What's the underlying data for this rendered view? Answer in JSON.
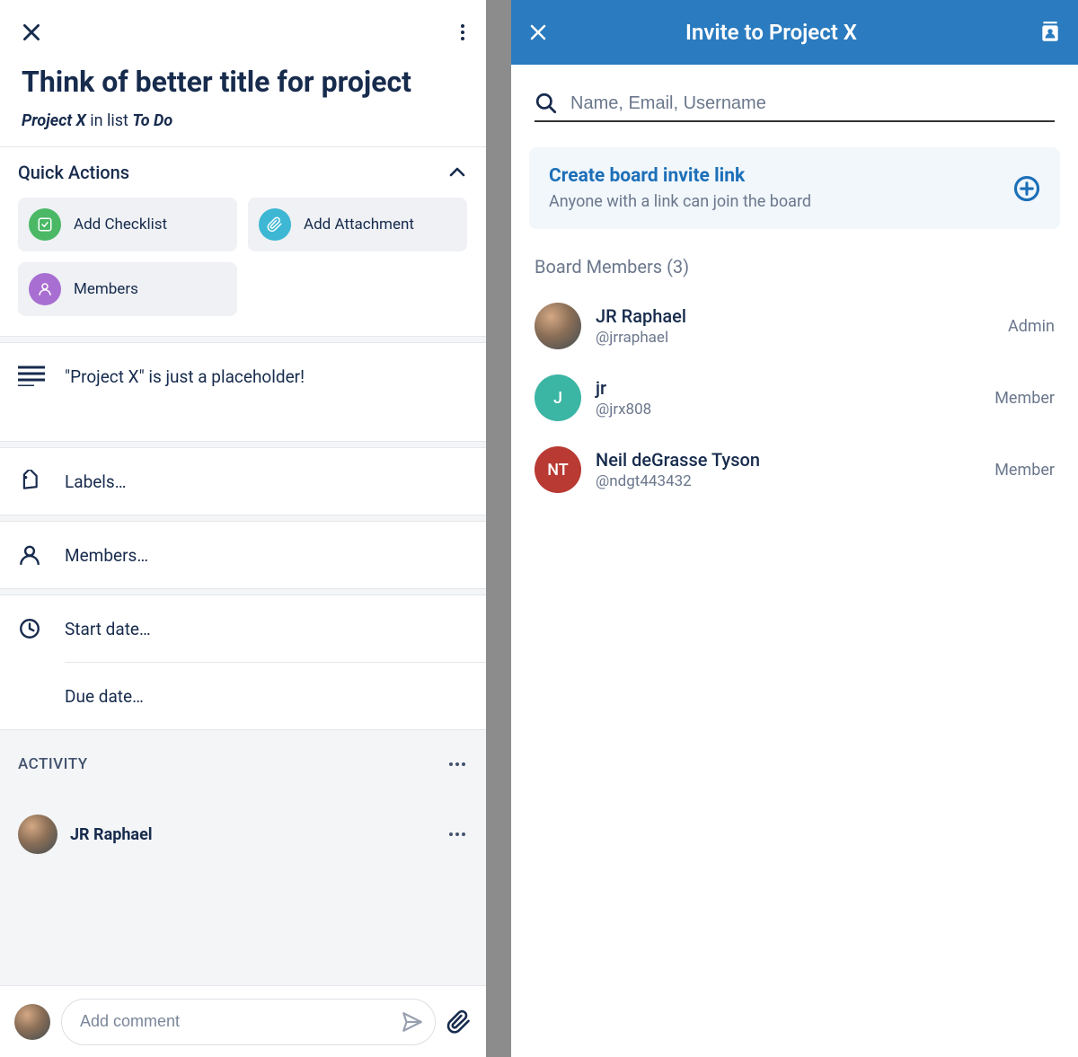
{
  "colors": {
    "accent_blue": "#2a7bbf",
    "link_blue": "#1d6fb8",
    "text_dark": "#172b4d",
    "text_muted": "#6b778c",
    "green": "#4bb866",
    "cyan": "#3db7d4",
    "purple": "#a86ed1",
    "red": "#b83a33",
    "teal": "#3bb5a4"
  },
  "left": {
    "card_title": "Think of better title for project",
    "subtitle_project": "Project X",
    "subtitle_middle": " in list ",
    "subtitle_list": "To Do",
    "quick_actions_title": "Quick Actions",
    "qa_checklist": "Add Checklist",
    "qa_attachment": "Add Attachment",
    "qa_members": "Members",
    "description": "\"Project X\" is just a placeholder!",
    "row_labels": "Labels…",
    "row_members": "Members…",
    "row_startdate": "Start date…",
    "row_duedate": "Due date…",
    "activity_title": "ACTIVITY",
    "activity_user": "JR Raphael",
    "comment_placeholder": "Add comment"
  },
  "right": {
    "header_title": "Invite to Project X",
    "search_placeholder": "Name, Email, Username",
    "invite_link_title": "Create board invite link",
    "invite_link_sub": "Anyone with a link can join the board",
    "board_members_title": "Board Members (3)",
    "members": [
      {
        "name": "JR Raphael",
        "handle": "@jrraphael",
        "role": "Admin",
        "avatar_type": "photo",
        "avatar_bg": "#8a6e56",
        "avatar_initials": ""
      },
      {
        "name": "jr",
        "handle": "@jrx808",
        "role": "Member",
        "avatar_type": "initials",
        "avatar_bg": "#3bb5a4",
        "avatar_initials": "J"
      },
      {
        "name": "Neil deGrasse Tyson",
        "handle": "@ndgt443432",
        "role": "Member",
        "avatar_type": "initials",
        "avatar_bg": "#b83a33",
        "avatar_initials": "NT"
      }
    ]
  }
}
